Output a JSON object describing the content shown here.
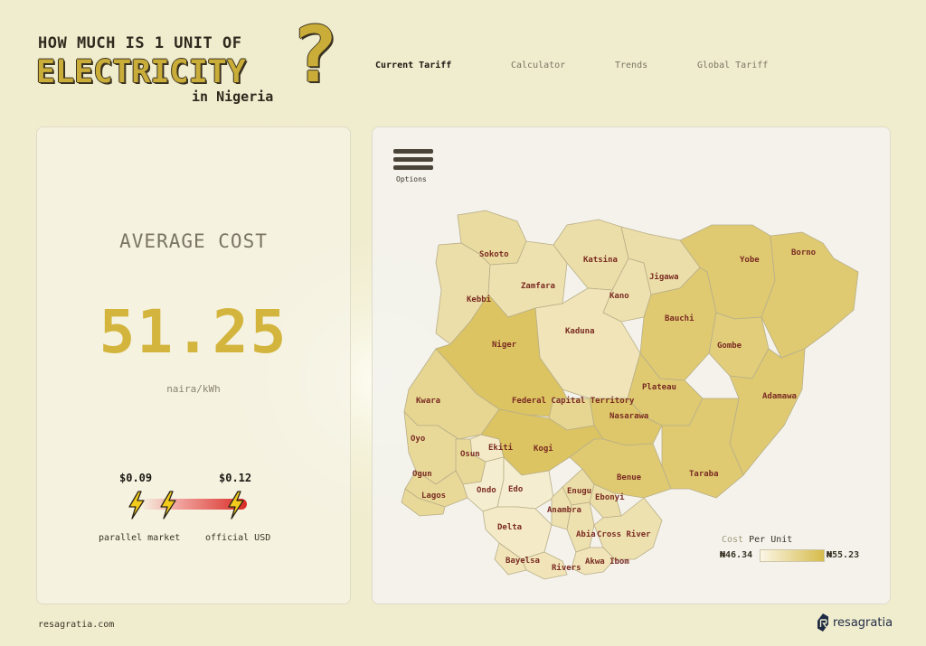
{
  "header": {
    "title_line1": "HOW MUCH IS 1 UNIT OF",
    "title_line2": "ELECTRICITY",
    "title_line3": "in Nigeria",
    "question_mark": "?"
  },
  "nav": {
    "tabs": [
      {
        "label": "Current Tariff",
        "active": true
      },
      {
        "label": "Calculator",
        "active": false
      },
      {
        "label": "Trends",
        "active": false
      },
      {
        "label": "Global Tariff",
        "active": false
      }
    ]
  },
  "summary": {
    "label": "AVERAGE COST",
    "value": "51.25",
    "unit": "naira/kWh",
    "parallel_rate": "$0.09",
    "official_rate": "$0.12",
    "parallel_label": "parallel market",
    "official_label": "official USD"
  },
  "map": {
    "options_label": "Options",
    "legend": {
      "prefix": "Cost",
      "title": "Per Unit",
      "min": "₦46.34",
      "max": "₦55.23",
      "color_low": "#fbf6e6",
      "color_high": "#d6bb4b"
    },
    "states": [
      {
        "name": "Sokoto",
        "level": 0.45
      },
      {
        "name": "Kebbi",
        "level": 0.4
      },
      {
        "name": "Zamfara",
        "level": 0.35
      },
      {
        "name": "Katsina",
        "level": 0.4
      },
      {
        "name": "Kano",
        "level": 0.35
      },
      {
        "name": "Jigawa",
        "level": 0.4
      },
      {
        "name": "Yobe",
        "level": 0.75
      },
      {
        "name": "Borno",
        "level": 0.75
      },
      {
        "name": "Bauchi",
        "level": 0.75
      },
      {
        "name": "Gombe",
        "level": 0.7
      },
      {
        "name": "Kaduna",
        "level": 0.3
      },
      {
        "name": "Niger",
        "level": 0.85
      },
      {
        "name": "Kwara",
        "level": 0.55
      },
      {
        "name": "Plateau",
        "level": 0.75
      },
      {
        "name": "Adamawa",
        "level": 0.75
      },
      {
        "name": "Federal Capital Territory",
        "level": 0.55
      },
      {
        "name": "Nasarawa",
        "level": 0.8
      },
      {
        "name": "Oyo",
        "level": 0.5
      },
      {
        "name": "Ekiti",
        "level": 0.2
      },
      {
        "name": "Osun",
        "level": 0.5
      },
      {
        "name": "Kogi",
        "level": 0.85
      },
      {
        "name": "Benue",
        "level": 0.75
      },
      {
        "name": "Taraba",
        "level": 0.75
      },
      {
        "name": "Ogun",
        "level": 0.5
      },
      {
        "name": "Ondo",
        "level": 0.15
      },
      {
        "name": "Edo",
        "level": 0.15
      },
      {
        "name": "Enugu",
        "level": 0.4
      },
      {
        "name": "Ebonyi",
        "level": 0.4
      },
      {
        "name": "Lagos",
        "level": 0.5
      },
      {
        "name": "Anambra",
        "level": 0.35
      },
      {
        "name": "Delta",
        "level": 0.2
      },
      {
        "name": "Abia",
        "level": 0.35
      },
      {
        "name": "Cross River",
        "level": 0.35
      },
      {
        "name": "Bayelsa",
        "level": 0.3
      },
      {
        "name": "Rivers",
        "level": 0.3
      },
      {
        "name": "Akwa Ibom",
        "level": 0.3
      }
    ]
  },
  "footer": {
    "site": "resagratia.com",
    "logo_text": "resagratia"
  }
}
